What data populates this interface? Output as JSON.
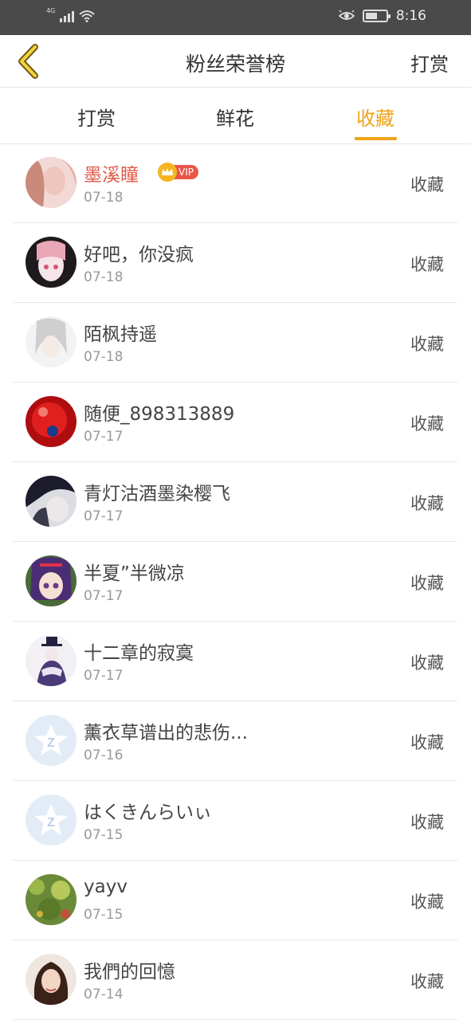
{
  "status_bar": {
    "network": "4G",
    "time": "8:16"
  },
  "header": {
    "title": "粉丝荣誉榜",
    "action": "打赏"
  },
  "tabs": [
    {
      "label": "打赏"
    },
    {
      "label": "鲜花"
    },
    {
      "label": "收藏"
    }
  ],
  "active_tab": "收藏",
  "accent_color": "#f0a319",
  "vip_badge": "VIP",
  "rows": [
    {
      "name": "墨溪瞳",
      "date": "07-18",
      "action": "收藏",
      "vip": true
    },
    {
      "name": "好吧，你没疯",
      "date": "07-18",
      "action": "收藏"
    },
    {
      "name": "陌枫持遥",
      "date": "07-18",
      "action": "收藏"
    },
    {
      "name": "随便_898313889",
      "date": "07-17",
      "action": "收藏"
    },
    {
      "name": "青灯沽酒墨染樱飞",
      "date": "07-17",
      "action": "收藏"
    },
    {
      "name": "半夏”半微凉",
      "date": "07-17",
      "action": "收藏"
    },
    {
      "name": "十二章的寂寞",
      "date": "07-17",
      "action": "收藏"
    },
    {
      "name": "薰衣草谱出的悲伤...",
      "date": "07-16",
      "action": "收藏"
    },
    {
      "name": "はくきんらいぃ",
      "date": "07-15",
      "action": "收藏"
    },
    {
      "name": "yayv",
      "date": "07-15",
      "action": "收藏"
    },
    {
      "name": "我們的回憶",
      "date": "07-14",
      "action": "收藏"
    }
  ]
}
